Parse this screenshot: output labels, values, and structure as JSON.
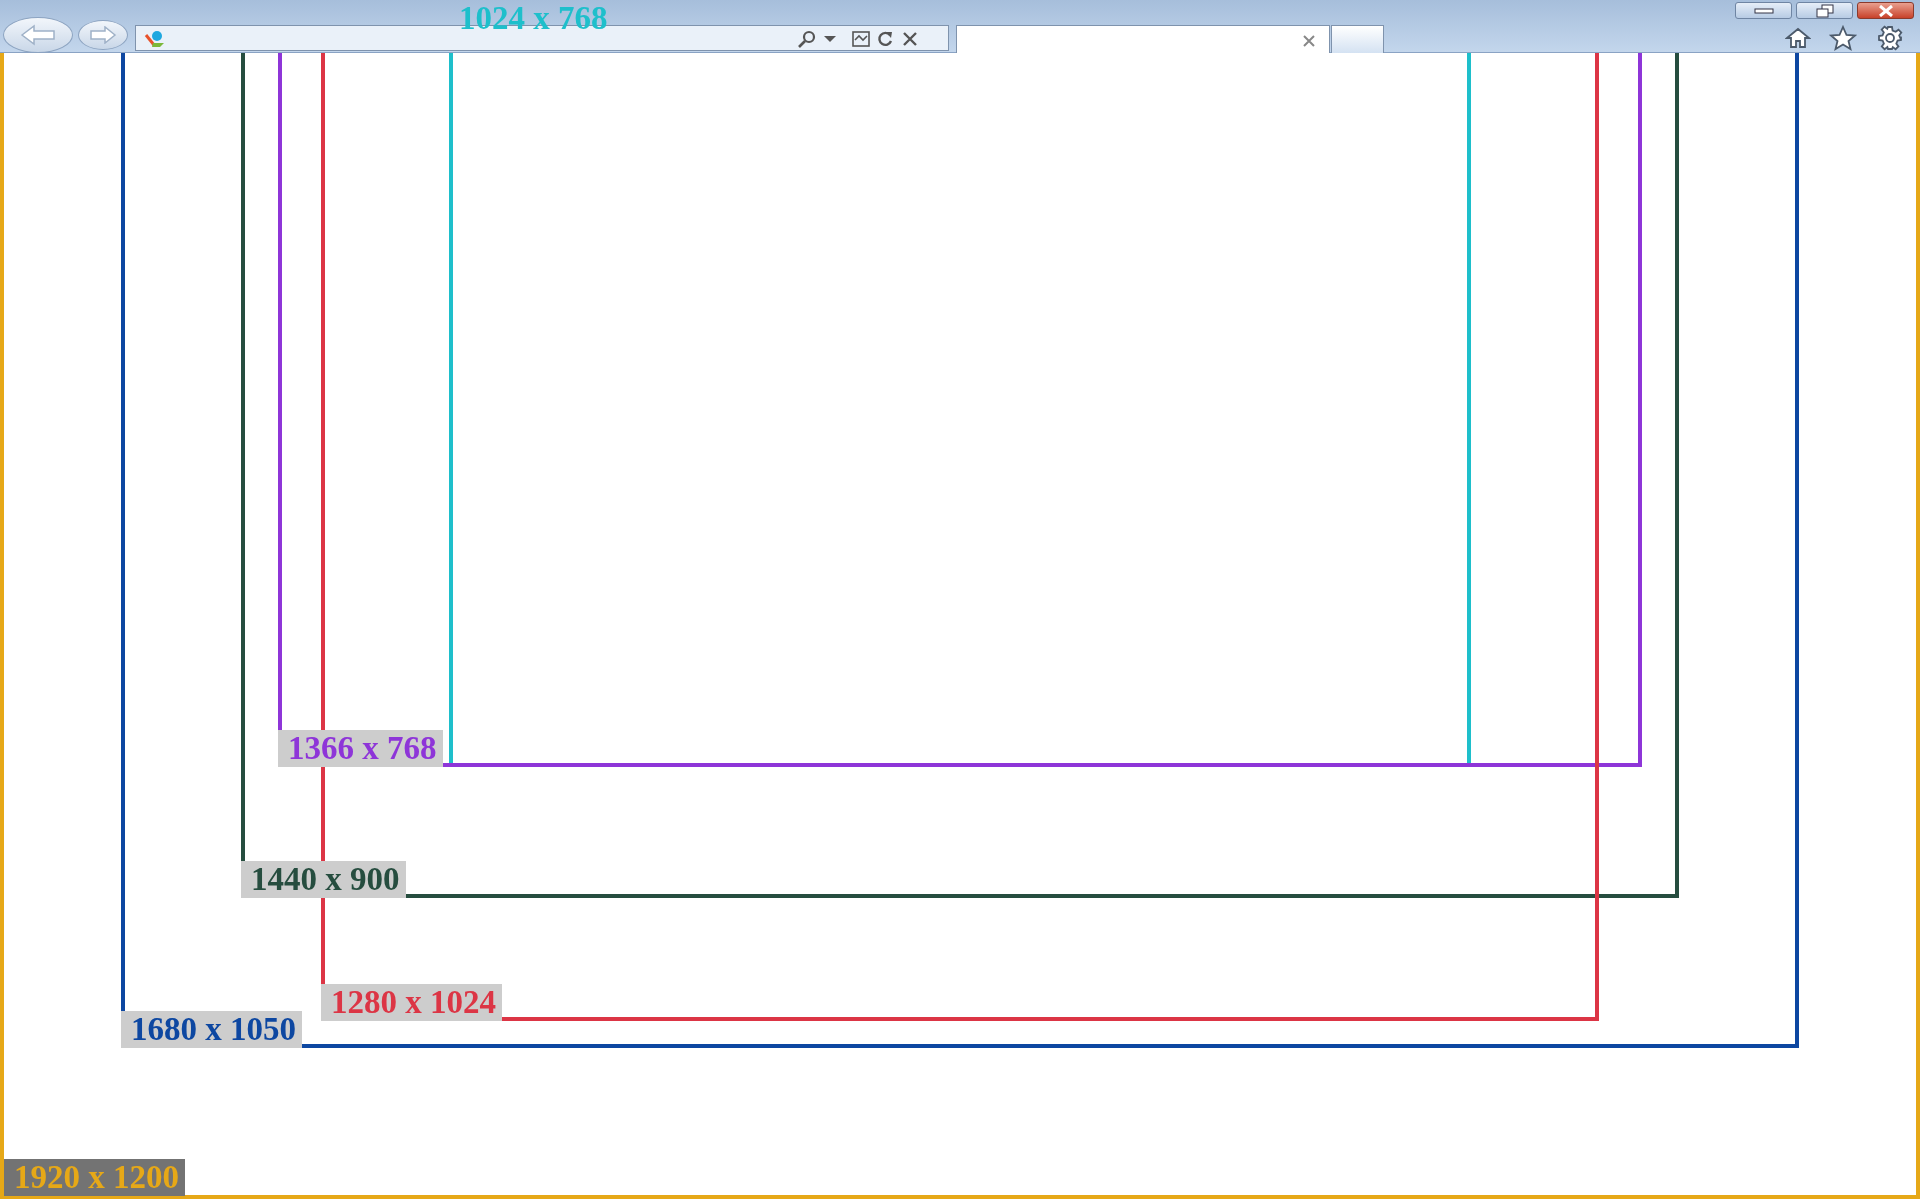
{
  "resolutions": [
    {
      "label": "1024 x 768",
      "color": "#1ebfcb",
      "kind": "top"
    },
    {
      "label": "1366 x 768",
      "color": "#8e35d8",
      "kind": "boxed"
    },
    {
      "label": "1440 x 900",
      "color": "#264d3f",
      "kind": "boxed"
    },
    {
      "label": "1280 x 1024",
      "color": "#dc3545",
      "kind": "boxed"
    },
    {
      "label": "1680 x 1050",
      "color": "#0d47a1",
      "kind": "boxed"
    },
    {
      "label": "1920 x 1200",
      "color": "#e6a817",
      "kind": "boxed"
    }
  ]
}
